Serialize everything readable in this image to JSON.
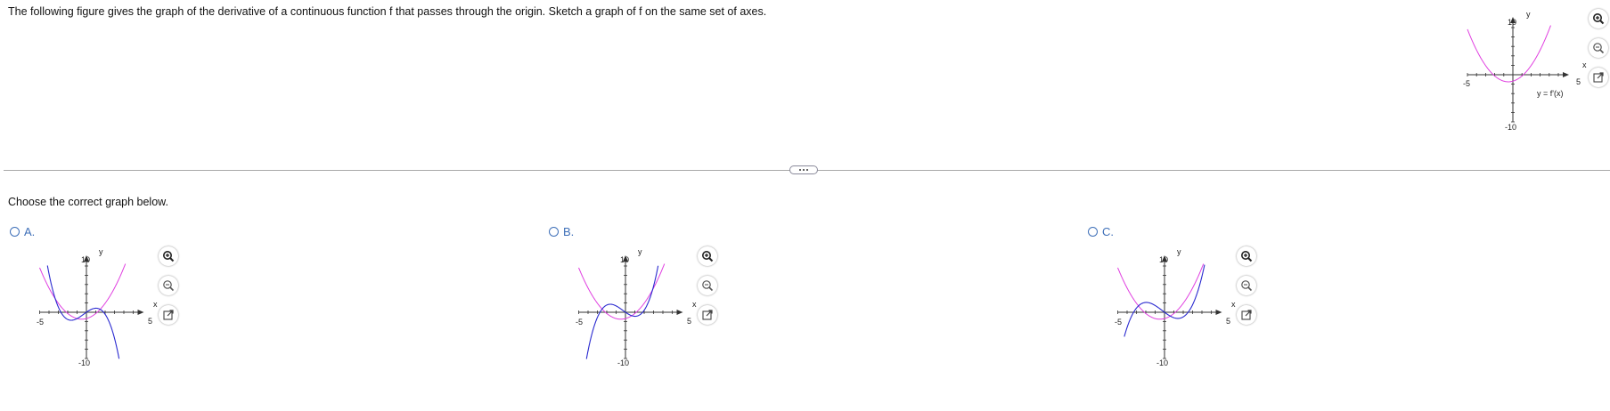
{
  "question": {
    "text": "The following figure gives the graph of the derivative of a continuous function f that passes through the origin. Sketch a graph of f on the same set of axes."
  },
  "main_graph": {
    "y_axis_label": "y",
    "x_axis_label": "x",
    "y_max_label": "10",
    "y_min_label": "-10",
    "x_min_label": "-5",
    "x_max_label": "5",
    "curve_label": "y = f'(x)",
    "derivative_color": "#e040e0"
  },
  "tools": {
    "zoom_in": "zoom-in-icon",
    "zoom_out": "zoom-out-icon",
    "popout": "popout-icon"
  },
  "prompt": "Choose the correct graph below.",
  "options": [
    {
      "letter": "A.",
      "y_axis_label": "y",
      "x_axis_label": "x",
      "y_max_label": "10",
      "y_min_label": "-10",
      "x_min_label": "-5",
      "x_max_label": "5",
      "candidate_color": "#2a2ad0"
    },
    {
      "letter": "B.",
      "y_axis_label": "y",
      "x_axis_label": "x",
      "y_max_label": "10",
      "y_min_label": "-10",
      "x_min_label": "-5",
      "x_max_label": "5",
      "candidate_color": "#2a2ad0"
    },
    {
      "letter": "C.",
      "y_axis_label": "y",
      "x_axis_label": "x",
      "y_max_label": "10",
      "y_min_label": "-10",
      "x_min_label": "-5",
      "x_max_label": "5",
      "candidate_color": "#2a2ad0"
    }
  ]
}
